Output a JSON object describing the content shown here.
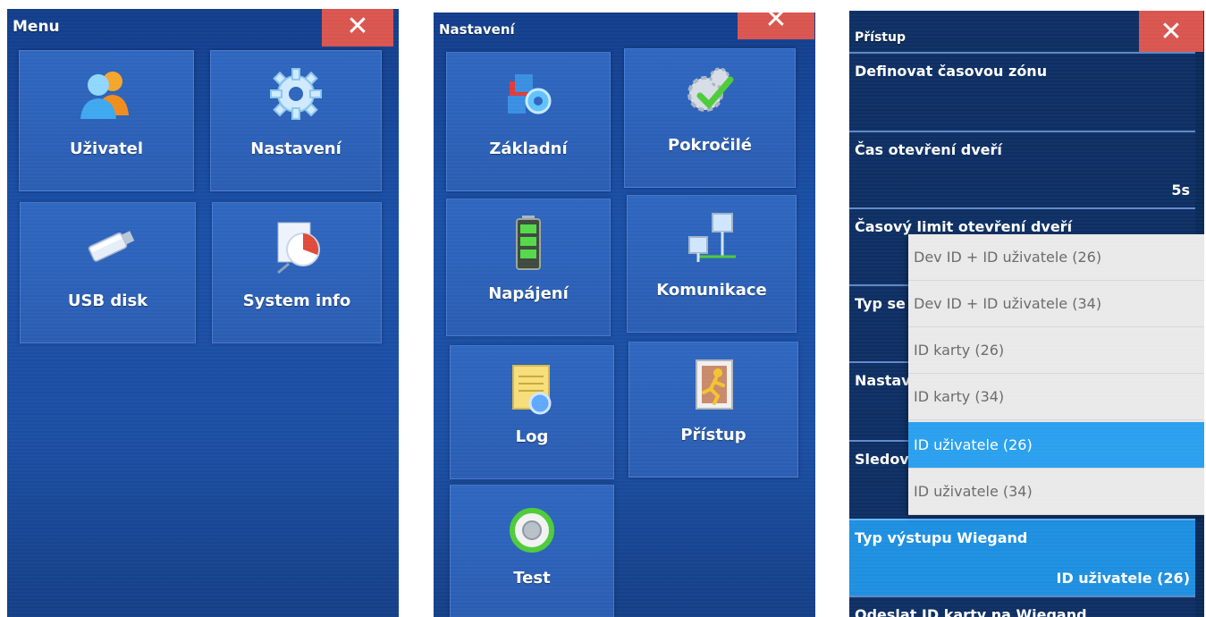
{
  "menu_screen": {
    "title": "Menu",
    "close": "✕",
    "tiles": [
      {
        "label": "Uživatel",
        "icon": "users-icon"
      },
      {
        "label": "Nastavení",
        "icon": "gear-icon"
      },
      {
        "label": "USB disk",
        "icon": "usb-drive-icon"
      },
      {
        "label": "System info",
        "icon": "system-info-icon"
      }
    ]
  },
  "settings_screen": {
    "title": "Nastavení",
    "close": "✕",
    "tiles": [
      {
        "label": "Základní",
        "icon": "basic-settings-icon"
      },
      {
        "label": "Pokročilé",
        "icon": "advanced-gear-check-icon"
      },
      {
        "label": "Napájení",
        "icon": "battery-icon"
      },
      {
        "label": "Komunikace",
        "icon": "network-computers-icon"
      },
      {
        "label": "Log",
        "icon": "log-notepad-icon"
      },
      {
        "label": "Přístup",
        "icon": "access-door-icon"
      },
      {
        "label": "Test",
        "icon": "test-dial-icon"
      }
    ]
  },
  "access_screen": {
    "title": "Přístup",
    "close": "✕",
    "rows": [
      {
        "label": "Definovat časovou zónu",
        "value": ""
      },
      {
        "label": "Čas otevření dveří",
        "value": "5s"
      },
      {
        "label": "Časový limit otevření dveří",
        "value": ""
      },
      {
        "label": "Typ se",
        "value": ""
      },
      {
        "label": "Nastav",
        "value": ""
      },
      {
        "label": "Sledov",
        "value": ""
      },
      {
        "label": "Typ výstupu Wiegand",
        "value": "ID uživatele (26)"
      },
      {
        "label": "Odeslat ID karty na Wiegand",
        "value": ""
      }
    ],
    "dropdown_options": [
      "Dev ID + ID uživatele (26)",
      "Dev ID + ID uživatele (34)",
      "ID karty (26)",
      "ID karty (34)",
      "ID uživatele (26)",
      "ID uživatele (34)"
    ],
    "selected_option": "ID uživatele (26)"
  },
  "colors": {
    "screen_blue": "#1a4fa6",
    "tile_blue": "#2e66bf",
    "close_red": "#d9554f",
    "highlight_blue": "#2aa0ee",
    "dropdown_bg": "#e9e9e9"
  }
}
